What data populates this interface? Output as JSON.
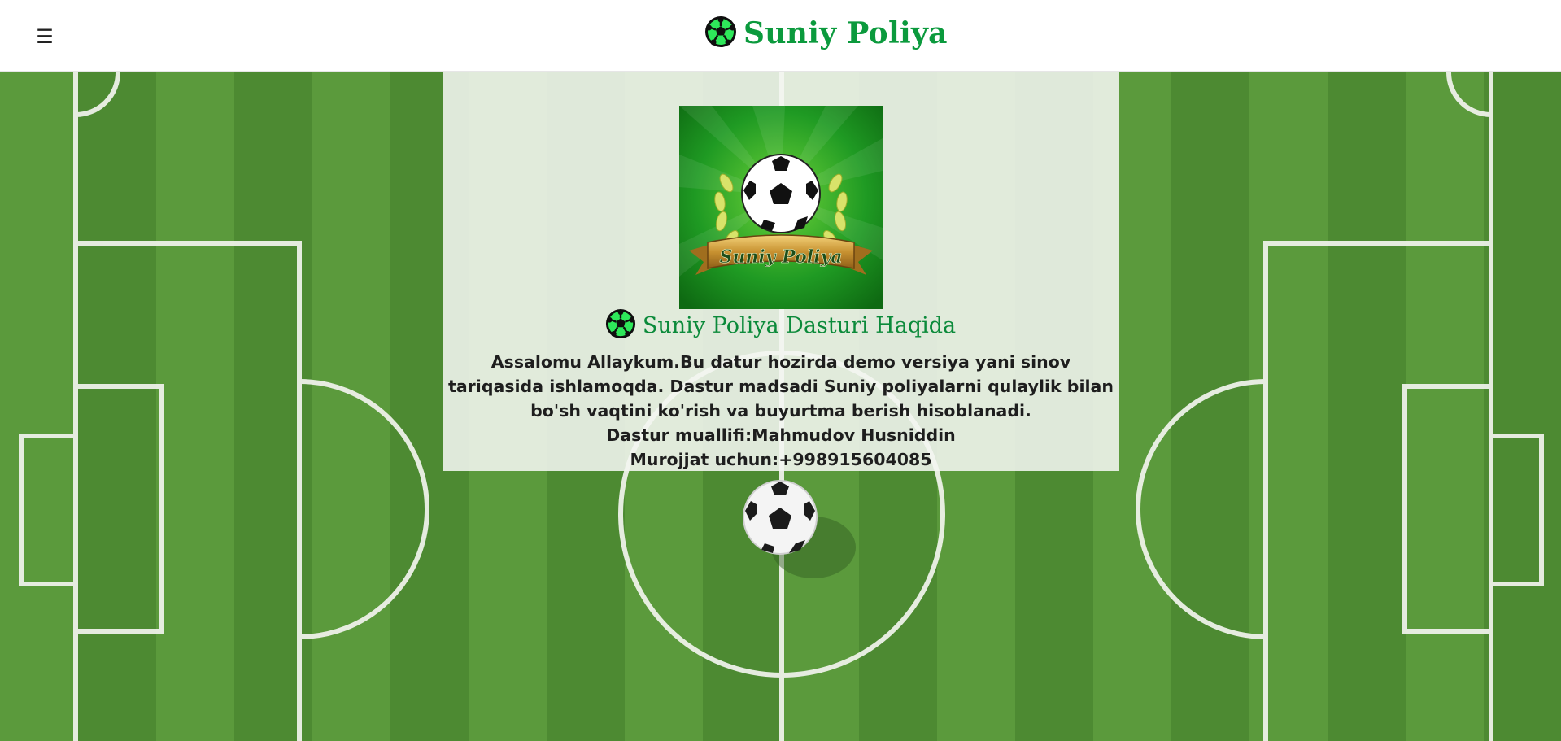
{
  "header": {
    "menu_icon": "☰",
    "brand_icon": "soccer-ball-icon",
    "brand_title": "Suniy Poliya"
  },
  "about": {
    "logo_banner_text": "Suniy Poliya",
    "title_icon": "soccer-ball-icon",
    "title": "Suniy Poliya Dasturi Haqida",
    "description": "Assalomu Allaykum.Bu datur hozirda demo versiya yani sinov tariqasida ishlamoqda. Dastur madsadi Suniy poliyalarni qulaylik bilan bo'sh vaqtini ko'rish va buyurtma berish hisoblanadi.",
    "author": "Dastur muallifi:Mahmudov Husniddin",
    "contact": "Murojjat uchun:+998915604085"
  },
  "colors": {
    "brand_green": "#0b9a3d",
    "pitch_light": "#5b9a3c",
    "pitch_dark": "#4d8a32",
    "card_bg": "#f4f6f1"
  }
}
